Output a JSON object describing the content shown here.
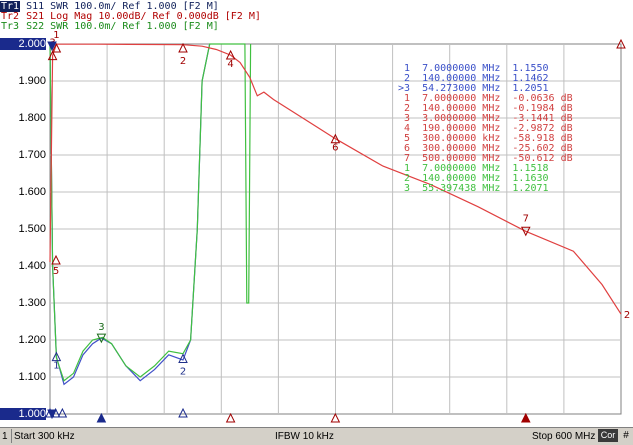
{
  "traces": [
    {
      "badge": "Tr1",
      "name": "S11",
      "format": "SWR 100.0m/ Ref 1.000 [F2 M]",
      "color": "#10205a",
      "selected": true
    },
    {
      "badge": "Tr2",
      "name": "S21",
      "format": "Log Mag 10.00dB/ Ref 0.000dB [F2 M]",
      "color": "#b00000",
      "selected": false
    },
    {
      "badge": "Tr3",
      "name": "S22",
      "format": "SWR 100.0m/ Ref 1.000 [F2 M]",
      "color": "#1a8a1a",
      "selected": false
    }
  ],
  "y_ticks": [
    "2.000",
    "1.900",
    "1.800",
    "1.700",
    "1.600",
    "1.500",
    "1.400",
    "1.300",
    "1.200",
    "1.100",
    "1.000"
  ],
  "markers": [
    {
      "id": " 1",
      "freq": "7.0000000 MHz",
      "value": "1.1550",
      "color": "#3a50c8"
    },
    {
      "id": " 2",
      "freq": "140.00000 MHz",
      "value": "1.1462",
      "color": "#3a50c8"
    },
    {
      "id": ">3",
      "freq": "54.273000 MHz",
      "value": "1.2051",
      "color": "#3a50c8"
    },
    {
      "id": " 1",
      "freq": "7.0000000 MHz",
      "value": "-0.0636 dB",
      "color": "#d04040"
    },
    {
      "id": " 2",
      "freq": "140.00000 MHz",
      "value": "-0.1984 dB",
      "color": "#d04040"
    },
    {
      "id": " 3",
      "freq": "3.0000000 MHz",
      "value": "-3.1441 dB",
      "color": "#d04040"
    },
    {
      "id": " 4",
      "freq": "190.00000 MHz",
      "value": "-2.9872 dB",
      "color": "#d04040"
    },
    {
      "id": " 5",
      "freq": "300.00000 kHz",
      "value": "-58.918 dB",
      "color": "#d04040"
    },
    {
      "id": " 6",
      "freq": "300.00000 MHz",
      "value": "-25.602 dB",
      "color": "#d04040"
    },
    {
      "id": " 7",
      "freq": "500.00000 MHz",
      "value": "-50.612 dB",
      "color": "#d04040"
    },
    {
      "id": " 1",
      "freq": "7.0000000 MHz",
      "value": "1.1518",
      "color": "#40c040"
    },
    {
      "id": " 2",
      "freq": "140.00000 MHz",
      "value": "1.1630",
      "color": "#40c040"
    },
    {
      "id": " 3",
      "freq": "55.397438 MHz",
      "value": "1.2071",
      "color": "#40c040"
    }
  ],
  "status": {
    "channel": "1",
    "start": "Start 300 kHz",
    "ifbw": "IFBW 10 kHz",
    "stop": "Stop 600 MHz",
    "cor": "Cor",
    "hash": "#"
  },
  "marker_labels": {
    "m1": "1",
    "m2": "2",
    "m3": "3",
    "m4": "4",
    "m5": "5",
    "m6": "6",
    "m7": "7",
    "tr2_end": "2"
  },
  "chart_data": {
    "type": "line",
    "x_unit": "MHz",
    "xlim": [
      0.3,
      600
    ],
    "ylim": [
      1.0,
      2.0
    ],
    "grid": true,
    "series": [
      {
        "name": "S11",
        "unit": "SWR",
        "color": "#4050c8",
        "x": [
          0.3,
          3,
          7,
          15,
          25,
          35,
          45,
          54.27,
          65,
          80,
          95,
          110,
          125,
          140,
          148,
          155,
          160,
          168
        ],
        "y": [
          2.0,
          1.4,
          1.155,
          1.08,
          1.1,
          1.16,
          1.19,
          1.205,
          1.19,
          1.13,
          1.09,
          1.12,
          1.16,
          1.146,
          1.2,
          1.5,
          1.9,
          2.0
        ]
      },
      {
        "name": "S22",
        "unit": "SWR",
        "color": "#40c040",
        "x": [
          0.3,
          3,
          7,
          15,
          25,
          35,
          45,
          55.4,
          65,
          80,
          95,
          110,
          125,
          140,
          148,
          155,
          160,
          168,
          205,
          207,
          209,
          211
        ],
        "y": [
          2.0,
          1.4,
          1.152,
          1.09,
          1.11,
          1.17,
          1.2,
          1.207,
          1.19,
          1.13,
          1.1,
          1.13,
          1.17,
          1.163,
          1.2,
          1.5,
          1.9,
          2.0,
          2.0,
          1.3,
          1.3,
          2.0
        ]
      },
      {
        "name": "S21",
        "unit": "dB",
        "ref": "0.000 dB",
        "scale": "10.00 dB/div",
        "color": "#e04040",
        "x": [
          0.3,
          3,
          7,
          50,
          140,
          160,
          175,
          190,
          200,
          210,
          218,
          225,
          235,
          300,
          350,
          400,
          450,
          500,
          550,
          580,
          600
        ],
        "y": [
          -58.918,
          -3.1441,
          -0.0636,
          -0.05,
          -0.1984,
          -0.6,
          -1.5,
          -2.9872,
          -5,
          -9,
          -14,
          -13,
          -15,
          -25.602,
          -33,
          -38,
          -44,
          -50.612,
          -56,
          -65,
          -73
        ]
      }
    ]
  }
}
